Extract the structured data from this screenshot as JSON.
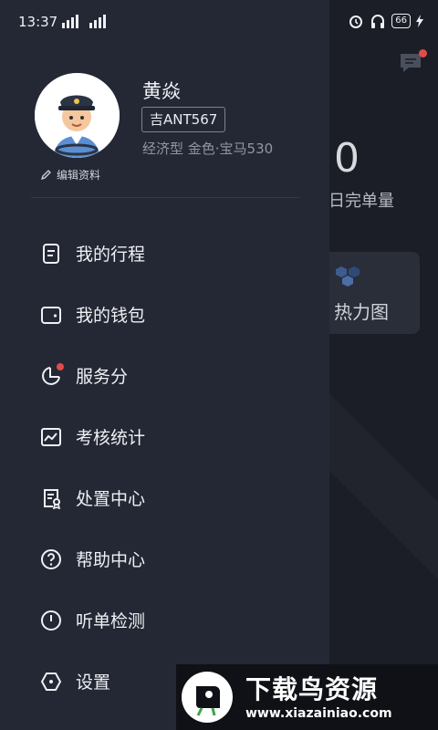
{
  "status_bar": {
    "time": "13:37",
    "signal1": "2G",
    "signal2": "4G",
    "battery": "66"
  },
  "background": {
    "count": "0",
    "count_label": "日完单量",
    "heatmap_label": "热力图"
  },
  "profile": {
    "name": "黄焱",
    "plate": "吉ANT567",
    "car_info": "经济型 金色·宝马530",
    "edit_label": "编辑资料"
  },
  "menu": [
    {
      "label": "我的行程",
      "icon": "document-icon"
    },
    {
      "label": "我的钱包",
      "icon": "wallet-icon"
    },
    {
      "label": "服务分",
      "icon": "pie-chart-icon",
      "badge": true
    },
    {
      "label": "考核统计",
      "icon": "chart-icon"
    },
    {
      "label": "处置中心",
      "icon": "certificate-icon"
    },
    {
      "label": "帮助中心",
      "icon": "help-icon"
    },
    {
      "label": "听单检测",
      "icon": "clock-icon"
    },
    {
      "label": "设置",
      "icon": "settings-icon"
    }
  ],
  "watermark": {
    "title": "下载鸟资源",
    "url": "www.xiazainiao.com"
  },
  "colors": {
    "drawer_bg": "#242834",
    "badge": "#e34a4a",
    "text": "#eef0f4"
  }
}
